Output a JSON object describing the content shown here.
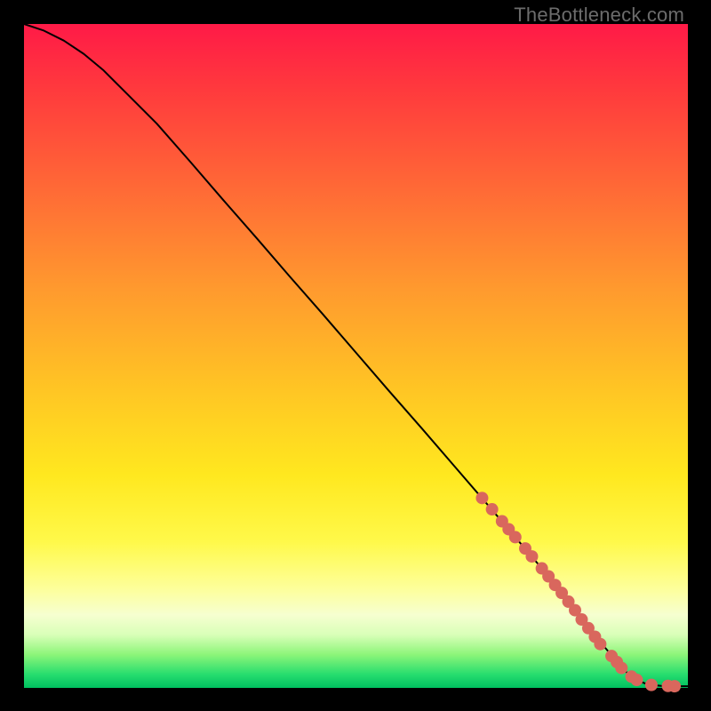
{
  "watermark": "TheBottleneck.com",
  "colors": {
    "curve": "#000000",
    "marker": "#d9675d",
    "page_bg": "#000000"
  },
  "chart_data": {
    "type": "line",
    "title": "",
    "xlabel": "",
    "ylabel": "",
    "xlim": [
      0,
      100
    ],
    "ylim": [
      0,
      100
    ],
    "grid": false,
    "legend": false,
    "curve": {
      "x": [
        0,
        3,
        6,
        9,
        12,
        15,
        20,
        25,
        30,
        35,
        40,
        45,
        50,
        55,
        60,
        65,
        70,
        74,
        78,
        82,
        85,
        88,
        90,
        92,
        94,
        96,
        98,
        100
      ],
      "y": [
        100,
        99,
        97.5,
        95.5,
        93,
        90,
        85,
        79.3,
        73.5,
        67.8,
        62,
        56.3,
        50.5,
        44.7,
        39,
        33.2,
        27.4,
        22.7,
        18,
        13,
        9,
        5.5,
        3.0,
        1.3,
        0.5,
        0.3,
        0.25,
        0.25
      ]
    },
    "markers": {
      "comment": "dotted/segmented overlay on the curve near the lower-right",
      "x": [
        69,
        70.5,
        72,
        73,
        74,
        75.5,
        76.5,
        78,
        79,
        80,
        81,
        82,
        83,
        84,
        85,
        86,
        86.8,
        88.5,
        89.3,
        90,
        91.5,
        92.3,
        94.5,
        97,
        98
      ],
      "y": [
        28.6,
        26.9,
        25.1,
        23.9,
        22.7,
        21.0,
        19.8,
        18.0,
        16.8,
        15.5,
        14.3,
        13.0,
        11.7,
        10.3,
        9.0,
        7.7,
        6.6,
        4.8,
        3.9,
        3.0,
        1.7,
        1.2,
        0.45,
        0.3,
        0.25
      ]
    }
  }
}
